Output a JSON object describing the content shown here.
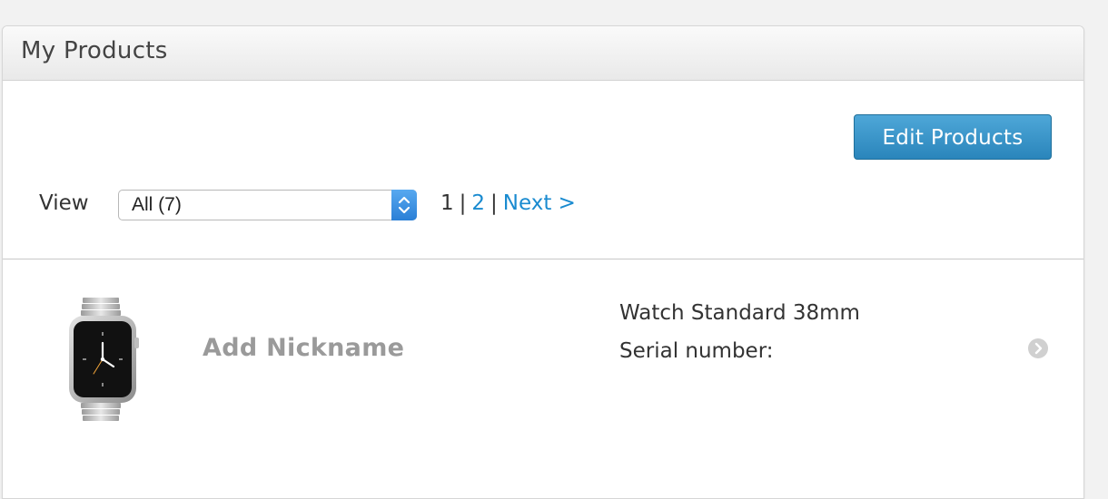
{
  "panel": {
    "title": "My Products"
  },
  "toolbar": {
    "edit_label": "Edit Products"
  },
  "filter": {
    "view_label": "View",
    "selected": "All (7)"
  },
  "pagination": {
    "current": "1",
    "separator": "|",
    "page2": "2",
    "next": "Next >"
  },
  "products": [
    {
      "nickname": "Add Nickname",
      "name": "Watch Standard 38mm",
      "serial_label": "Serial number:"
    }
  ],
  "colors": {
    "accent_button": "#2a85bb",
    "link": "#1a8bd0",
    "nickname": "#9a9a9a",
    "select_arrow": "#2a7fd6"
  },
  "icons": {
    "select": "chevron-up-down-icon",
    "row": "chevron-right-circle-icon",
    "product": "apple-watch-image"
  }
}
